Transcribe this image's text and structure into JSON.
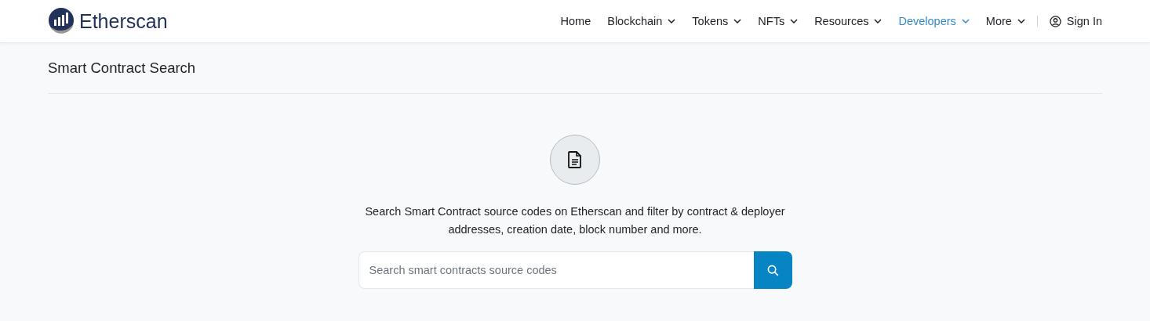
{
  "header": {
    "brand": "Etherscan",
    "nav": [
      {
        "label": "Home",
        "dropdown": false,
        "selected": false
      },
      {
        "label": "Blockchain",
        "dropdown": true,
        "selected": false
      },
      {
        "label": "Tokens",
        "dropdown": true,
        "selected": false
      },
      {
        "label": "NFTs",
        "dropdown": true,
        "selected": false
      },
      {
        "label": "Resources",
        "dropdown": true,
        "selected": false
      },
      {
        "label": "Developers",
        "dropdown": true,
        "selected": true
      },
      {
        "label": "More",
        "dropdown": true,
        "selected": false
      }
    ],
    "sign_in": "Sign In"
  },
  "page": {
    "title": "Smart Contract Search",
    "description": "Search Smart Contract source codes on Etherscan and filter by contract & deployer addresses, creation date, block number and more.",
    "search": {
      "placeholder": "Search smart contracts source codes"
    }
  }
}
